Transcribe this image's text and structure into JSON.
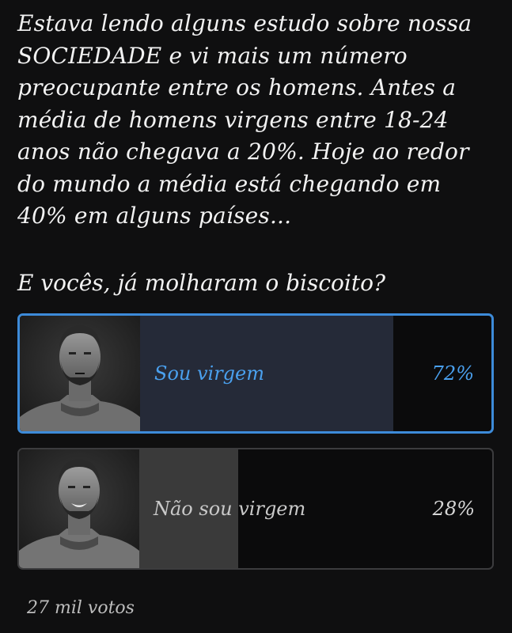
{
  "post": {
    "text": "Estava lendo alguns estudo sobre nossa SOCIEDADE e vi mais um número preocupante entre os homens. Antes a média de homens virgens entre 18-24 anos não chegava a 20%. Hoje ao redor do mundo a média está chegando em 40% em alguns países...",
    "question": "E vocês, já molharam o biscoito?"
  },
  "poll": {
    "options": [
      {
        "label": "Sou virgem",
        "percent_text": "72%",
        "percent": 72,
        "selected": true,
        "thumbnail": "man-serious-portrait"
      },
      {
        "label": "Não sou virgem",
        "percent_text": "28%",
        "percent": 28,
        "selected": false,
        "thumbnail": "man-smiling-portrait"
      }
    ],
    "votes": "27 mil votos"
  },
  "colors": {
    "background": "#0f0f10",
    "accent": "#3d8bd9",
    "selected_text": "#4aa0ee",
    "selected_fill": "#252a38",
    "unselected_fill": "#3a3a3a"
  }
}
